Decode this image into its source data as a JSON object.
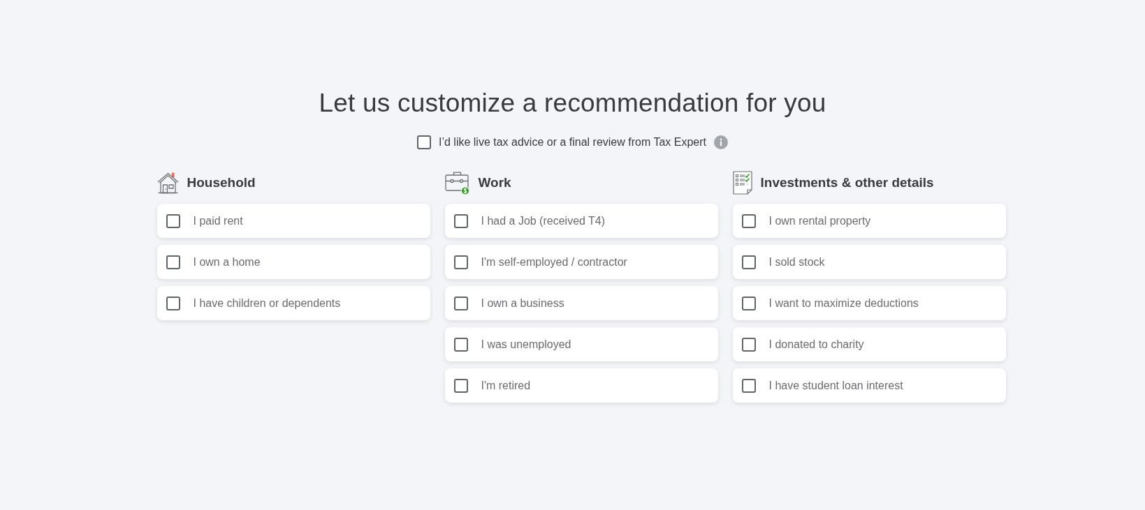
{
  "title": "Let us customize a recommendation for you",
  "expert_option": {
    "label": "I’d like live tax advice or a final review from Tax Expert",
    "checked": false
  },
  "categories": [
    {
      "kind": "household",
      "title": "Household",
      "options": [
        {
          "label": "I paid rent",
          "checked": false
        },
        {
          "label": "I own a home",
          "checked": false
        },
        {
          "label": "I have children or dependents",
          "checked": false
        }
      ]
    },
    {
      "kind": "work",
      "title": "Work",
      "options": [
        {
          "label": "I had a Job (received T4)",
          "checked": false
        },
        {
          "label": "I'm self-employed / contractor",
          "checked": false
        },
        {
          "label": "I own a business",
          "checked": false
        },
        {
          "label": "I was unemployed",
          "checked": false
        },
        {
          "label": "I'm retired",
          "checked": false
        }
      ]
    },
    {
      "kind": "investments",
      "title": "Investments & other details",
      "options": [
        {
          "label": "I own rental property",
          "checked": false
        },
        {
          "label": "I sold stock",
          "checked": false
        },
        {
          "label": "I want to maximize deductions",
          "checked": false
        },
        {
          "label": "I donated to charity",
          "checked": false
        },
        {
          "label": "I have student loan interest",
          "checked": false
        }
      ]
    }
  ]
}
